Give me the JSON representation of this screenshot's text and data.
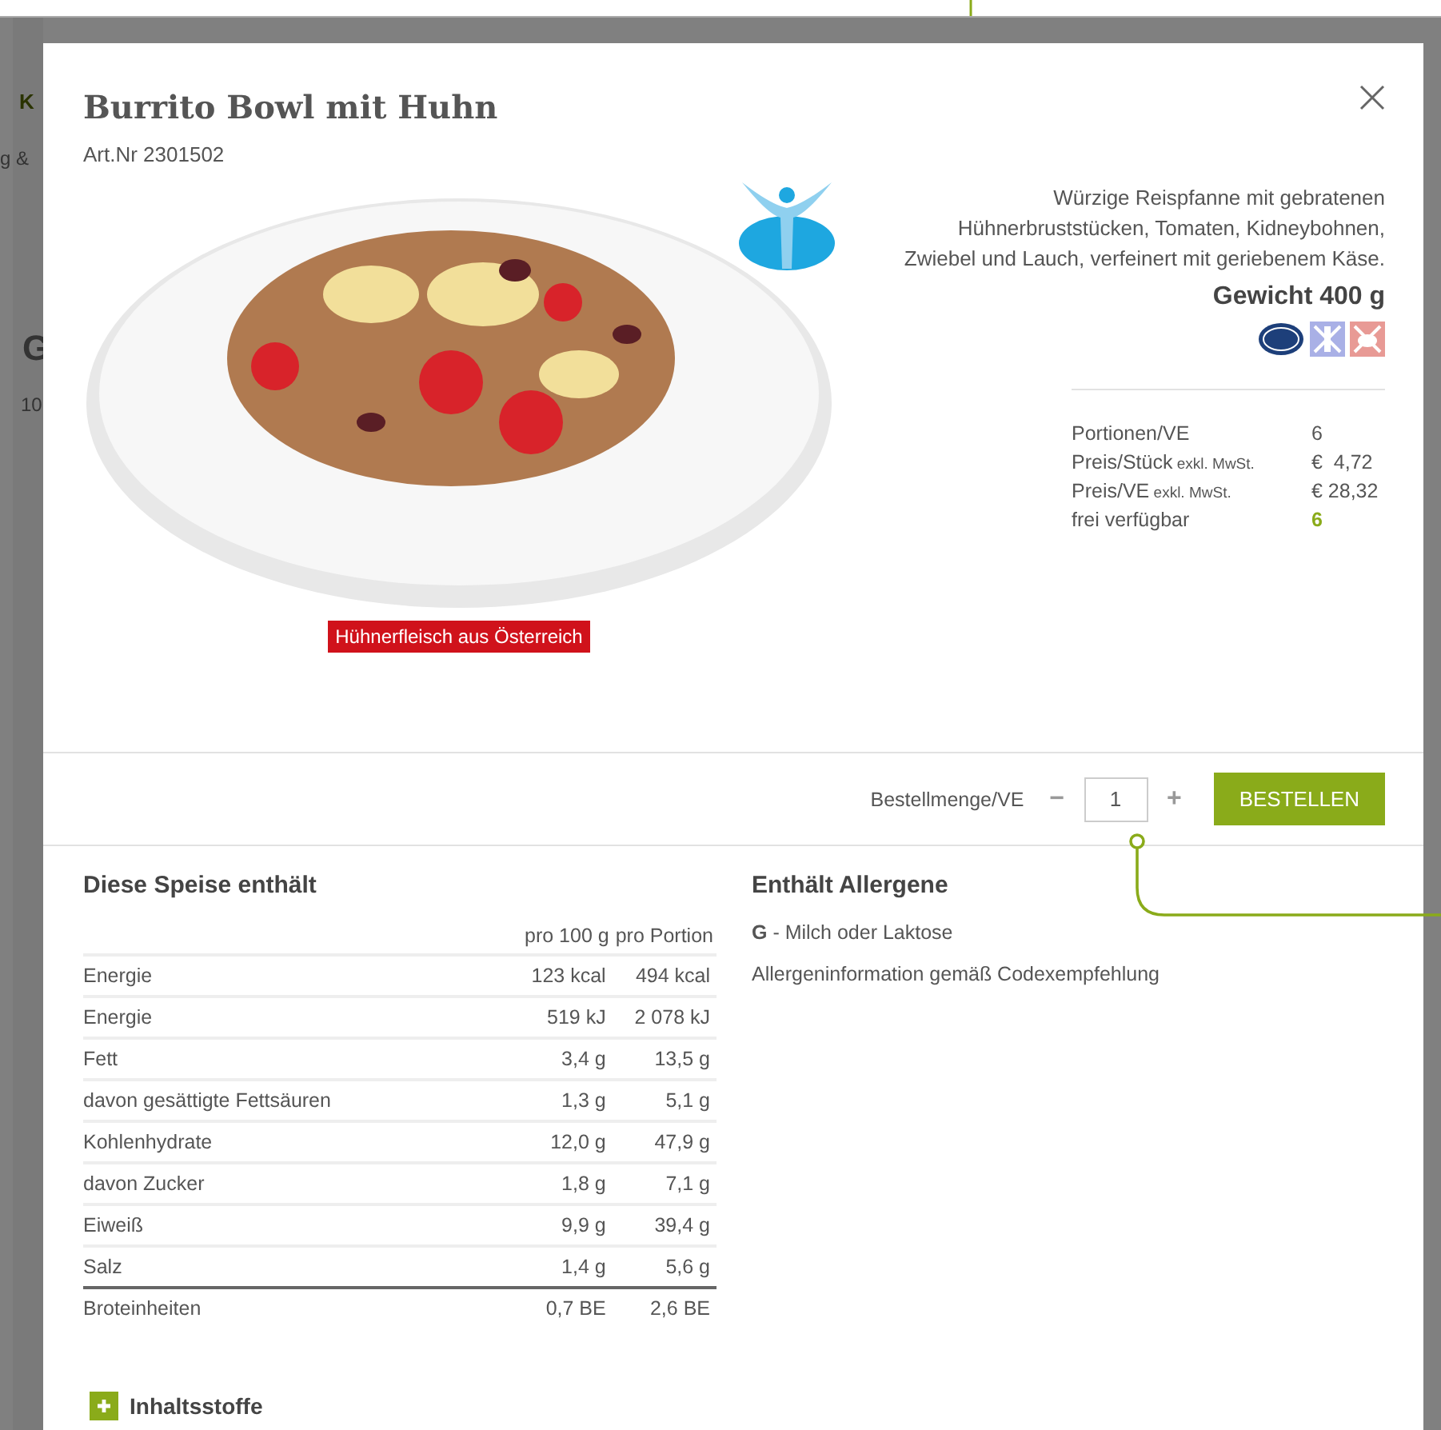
{
  "background_fragments": [
    {
      "text": "K"
    },
    {
      "text": "g &"
    },
    {
      "text": "G"
    },
    {
      "text": "10"
    }
  ],
  "dialog": {
    "title": "Burrito Bowl mit Huhn",
    "article_number": "Art.Nr 2301502",
    "origin_label": "Hühnerfleisch aus Österreich",
    "description": "Würzige Reispfanne mit gebratenen Hühnerbruststücken, Tomaten, Kidneybohnen, Zwiebel und Lauch, verfeinert mit geriebenem Käse.",
    "weight": "Gewicht 400 g",
    "details": [
      {
        "label": "Portionen/VE",
        "value": "6",
        "highlight": false
      },
      {
        "label": "Preis/Stück",
        "note": "exkl. MwSt.",
        "value": "€  4,72",
        "highlight": false
      },
      {
        "label": "Preis/VE",
        "note": "exkl. MwSt.",
        "value": "€ 28,32",
        "highlight": false
      },
      {
        "label": "frei verfügbar",
        "value": "6",
        "highlight": true
      }
    ],
    "order": {
      "label": "Bestellmenge/VE",
      "minus": "−",
      "quantity": "1",
      "plus": "+",
      "button": "BESTELLEN"
    },
    "nutrition": {
      "title": "Diese Speise enthält",
      "columns": [
        "pro 100 g",
        "pro Portion"
      ],
      "rows": [
        {
          "name": "Energie",
          "per_100g": "123 kcal",
          "per_portion": "494 kcal"
        },
        {
          "name": "Energie",
          "per_100g": "519 kJ",
          "per_portion": "2 078 kJ"
        },
        {
          "name": "Fett",
          "per_100g": "3,4 g",
          "per_portion": "13,5 g"
        },
        {
          "name": "davon gesättigte Fettsäuren",
          "per_100g": "1,3 g",
          "per_portion": "5,1 g"
        },
        {
          "name": "Kohlenhydrate",
          "per_100g": "12,0 g",
          "per_portion": "47,9 g"
        },
        {
          "name": "davon Zucker",
          "per_100g": "1,8 g",
          "per_portion": "7,1 g"
        },
        {
          "name": "Eiweiß",
          "per_100g": "9,9 g",
          "per_portion": "39,4 g"
        },
        {
          "name": "Salz",
          "per_100g": "1,4 g",
          "per_portion": "5,6 g"
        },
        {
          "name": "Broteinheiten",
          "per_100g": "0,7 BE",
          "per_portion": "2,6 BE"
        }
      ]
    },
    "allergens": {
      "title": "Enthält Allergene",
      "items": [
        {
          "text": "**G** - Milch oder Laktose"
        }
      ],
      "note": "Allergeninformation gemäß Codexempfehlung"
    },
    "ingredients_toggle": {
      "label": "Inhaltsstoffe",
      "expanded": false
    }
  }
}
